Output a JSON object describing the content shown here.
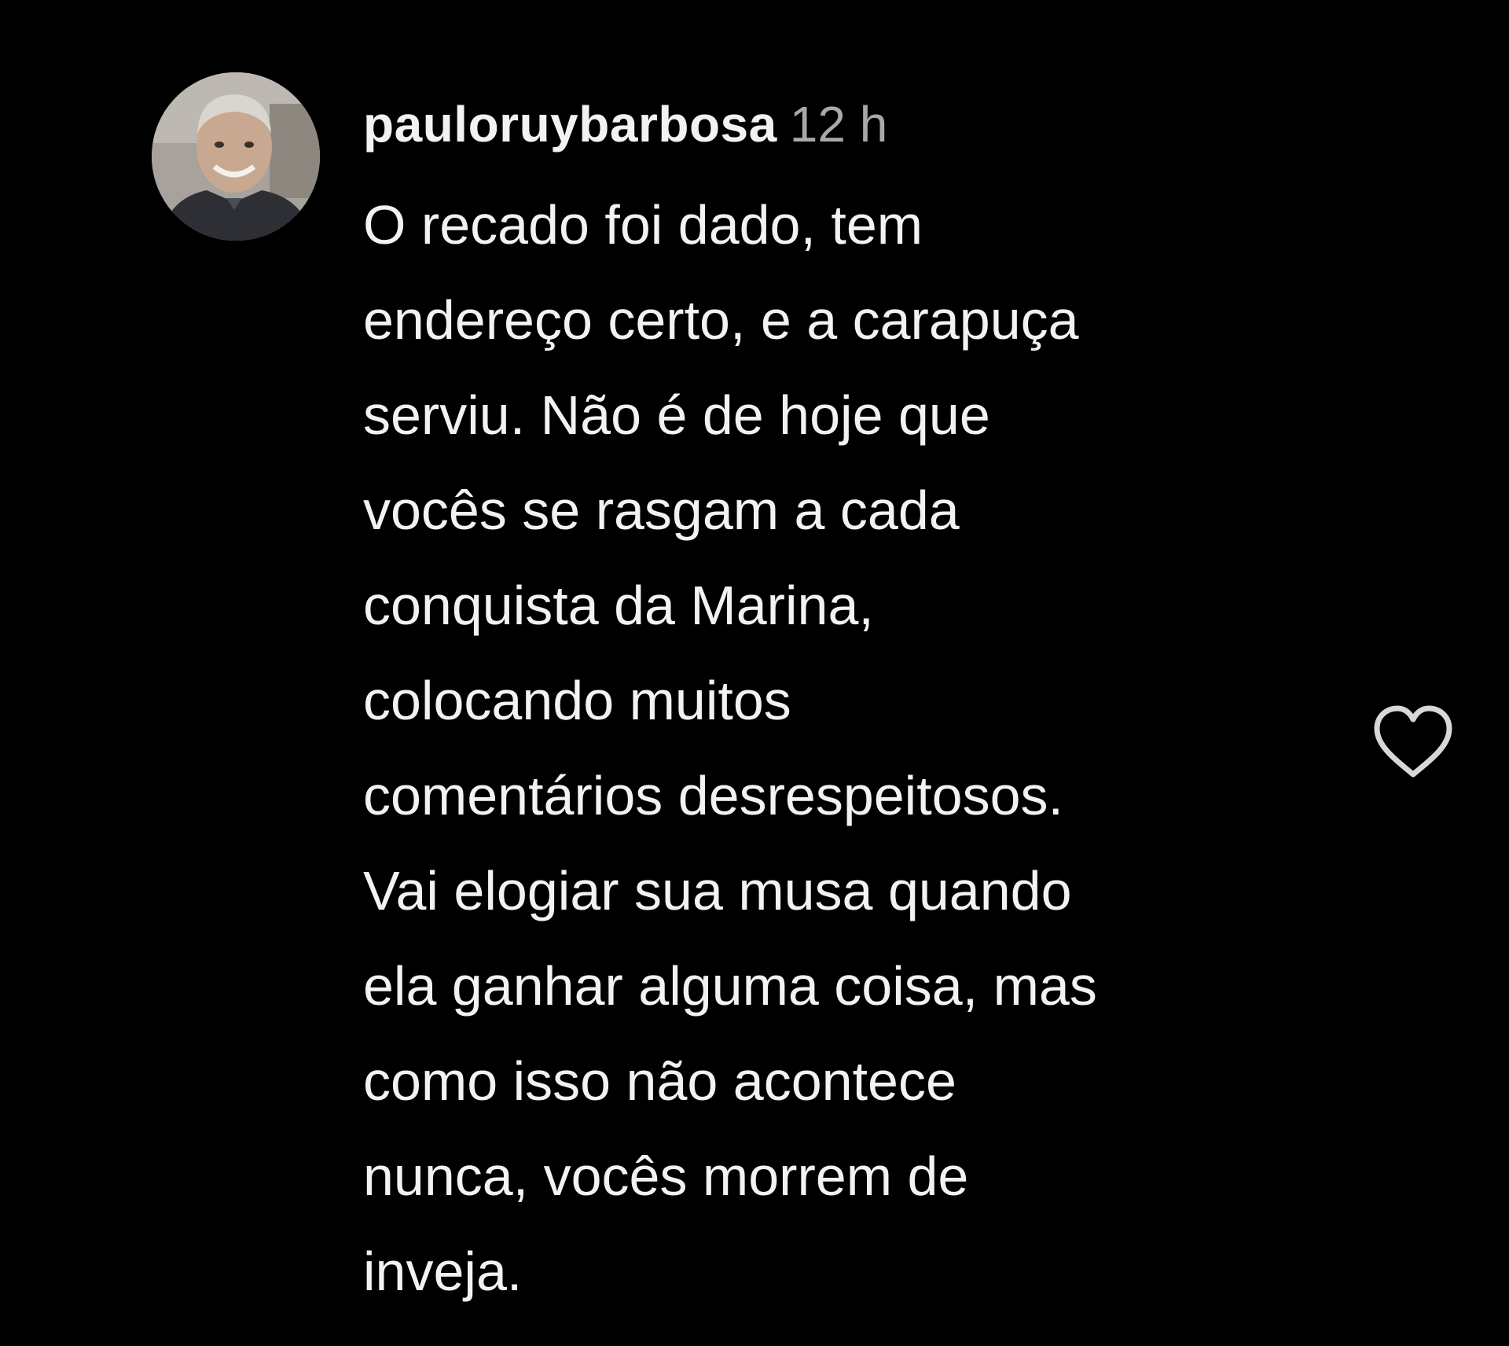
{
  "comment": {
    "username": "pauloruybarbosa",
    "timestamp": "12 h",
    "text_lines": [
      "O recado foi dado, tem",
      "endereço certo, e a carapuça",
      "serviu. Não é de hoje que",
      "vocês se rasgam a cada",
      "conquista da Marina,",
      "colocando muitos",
      "comentários desrespeitosos.",
      "Vai elogiar sua musa quando",
      "ela ganhar alguma coisa, mas",
      "como isso não acontece",
      "nunca, vocês morrem de",
      "inveja."
    ],
    "avatar_icon": "profile-photo-avatar",
    "like_icon": "heart-outline-icon"
  },
  "colors": {
    "background": "#000000",
    "text": "#f2f2f2",
    "timestamp": "#a8a8a8",
    "icon": "#d8d8d8"
  }
}
